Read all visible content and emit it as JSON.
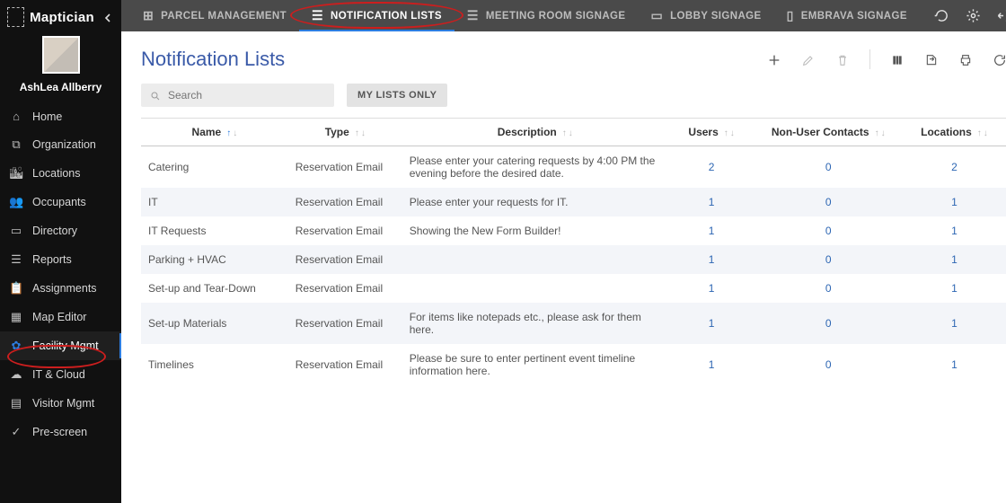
{
  "brand": "Maptician",
  "user": {
    "name": "AshLea Allberry"
  },
  "sidebar": {
    "items": [
      {
        "label": "Home",
        "icon": "home-icon"
      },
      {
        "label": "Organization",
        "icon": "org-icon"
      },
      {
        "label": "Locations",
        "icon": "buildings-icon"
      },
      {
        "label": "Occupants",
        "icon": "people-icon"
      },
      {
        "label": "Directory",
        "icon": "idcard-icon"
      },
      {
        "label": "Reports",
        "icon": "list-icon"
      },
      {
        "label": "Assignments",
        "icon": "clipboard-icon"
      },
      {
        "label": "Map Editor",
        "icon": "map-icon"
      },
      {
        "label": "Facility Mgmt",
        "icon": "gear-icon"
      },
      {
        "label": "IT & Cloud",
        "icon": "cloud-icon"
      },
      {
        "label": "Visitor Mgmt",
        "icon": "badge-icon"
      },
      {
        "label": "Pre-screen",
        "icon": "check-icon"
      }
    ],
    "activeIndex": 8
  },
  "topbar": {
    "tabs": [
      {
        "label": "PARCEL MANAGEMENT",
        "icon": "box-icon"
      },
      {
        "label": "NOTIFICATION LISTS",
        "icon": "list-icon"
      },
      {
        "label": "MEETING ROOM SIGNAGE",
        "icon": "list-icon"
      },
      {
        "label": "LOBBY SIGNAGE",
        "icon": "monitor-icon"
      },
      {
        "label": "EMBRAVA SIGNAGE",
        "icon": "device-icon"
      }
    ],
    "activeIndex": 1
  },
  "page": {
    "title": "Notification Lists",
    "search_placeholder": "Search",
    "mylists_label": "MY LISTS ONLY"
  },
  "table": {
    "columns": [
      "Name",
      "Type",
      "Description",
      "Users",
      "Non-User Contacts",
      "Locations"
    ],
    "rows": [
      {
        "name": "Catering",
        "type": "Reservation Email",
        "desc": "Please enter your catering requests by 4:00 PM the evening before the desired date.",
        "users": 2,
        "nonuser": 0,
        "locations": 2
      },
      {
        "name": "IT",
        "type": "Reservation Email",
        "desc": "Please enter your requests for IT.",
        "users": 1,
        "nonuser": 0,
        "locations": 1
      },
      {
        "name": "IT Requests",
        "type": "Reservation Email",
        "desc": "Showing the New Form Builder!",
        "users": 1,
        "nonuser": 0,
        "locations": 1
      },
      {
        "name": "Parking + HVAC",
        "type": "Reservation Email",
        "desc": "",
        "users": 1,
        "nonuser": 0,
        "locations": 1
      },
      {
        "name": "Set-up and Tear-Down",
        "type": "Reservation Email",
        "desc": "",
        "users": 1,
        "nonuser": 0,
        "locations": 1
      },
      {
        "name": "Set-up Materials",
        "type": "Reservation Email",
        "desc": "For items like notepads etc., please ask for them here.",
        "users": 1,
        "nonuser": 0,
        "locations": 1
      },
      {
        "name": "Timelines",
        "type": "Reservation Email",
        "desc": "Please be sure to enter pertinent event timeline information here.",
        "users": 1,
        "nonuser": 0,
        "locations": 1
      }
    ]
  }
}
